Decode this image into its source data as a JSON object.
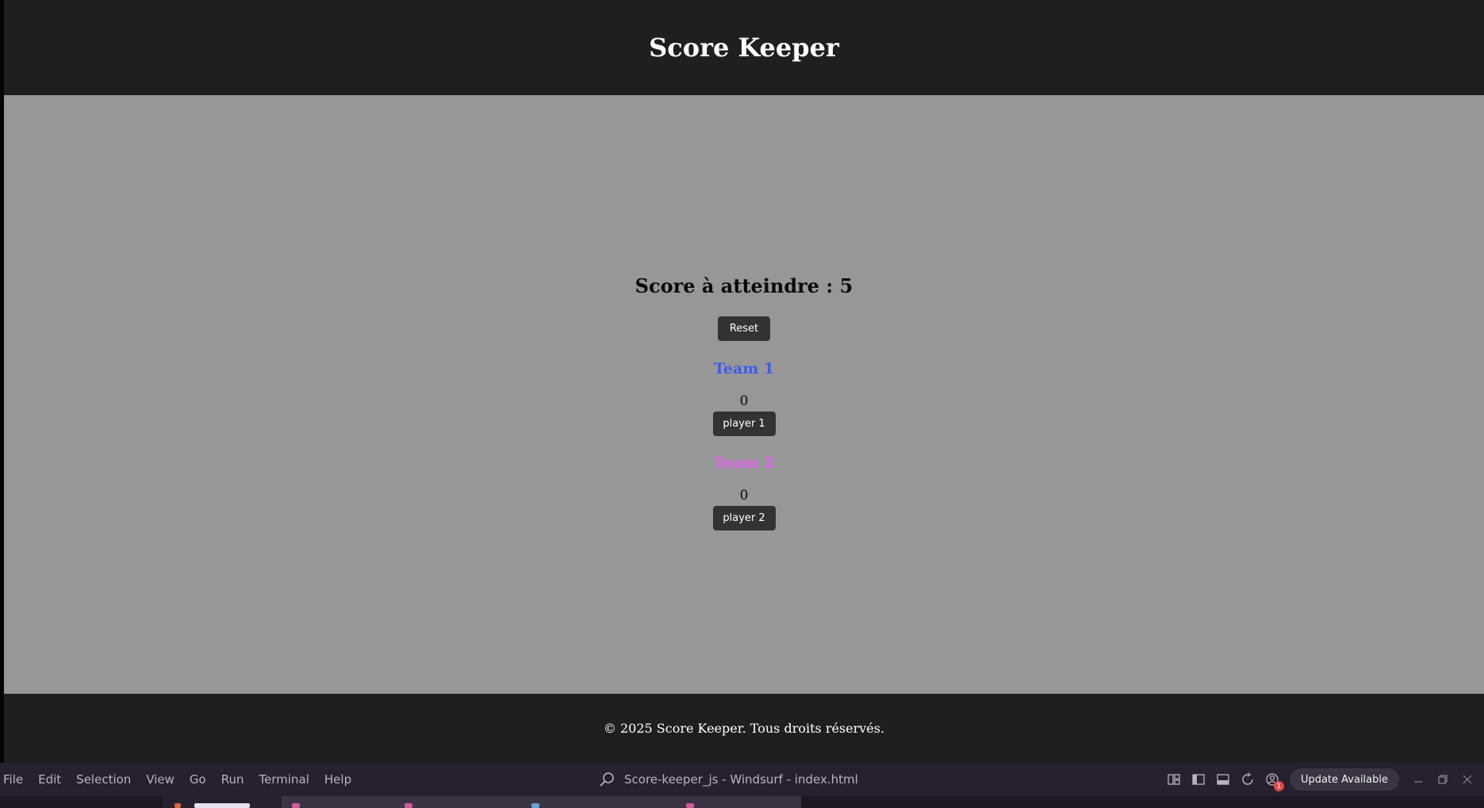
{
  "header": {
    "title": "Score Keeper"
  },
  "game": {
    "target_label": "Score à atteindre : 5",
    "reset_label": "Reset",
    "team1": {
      "name": "Team 1",
      "score": "0",
      "button_label": "player 1",
      "color": "#3d5cf2"
    },
    "team2": {
      "name": "Team 2",
      "score": "0",
      "button_label": "player 2",
      "color": "#e060f0"
    }
  },
  "footer": {
    "text": "© 2025 Score Keeper. Tous droits réservés."
  },
  "ide": {
    "menu": [
      "File",
      "Edit",
      "Selection",
      "View",
      "Go",
      "Run",
      "Terminal",
      "Help"
    ],
    "window_title": "Score-keeper_js - Windsurf - index.html",
    "update_label": "Update Available",
    "notification_count": "1"
  },
  "colors": {
    "header_bg": "#1f1f1f",
    "main_bg": "#979797",
    "button_bg": "#333333",
    "ide_bar_bg": "#27202f"
  },
  "icons": {
    "search": "search-icon",
    "layout": "layout-icon",
    "sidebar": "sidebar-toggle-icon",
    "panel": "panel-toggle-icon",
    "sync": "sync-icon",
    "account": "account-icon",
    "minimize": "minimize-icon",
    "restore": "restore-icon",
    "close": "close-icon"
  }
}
